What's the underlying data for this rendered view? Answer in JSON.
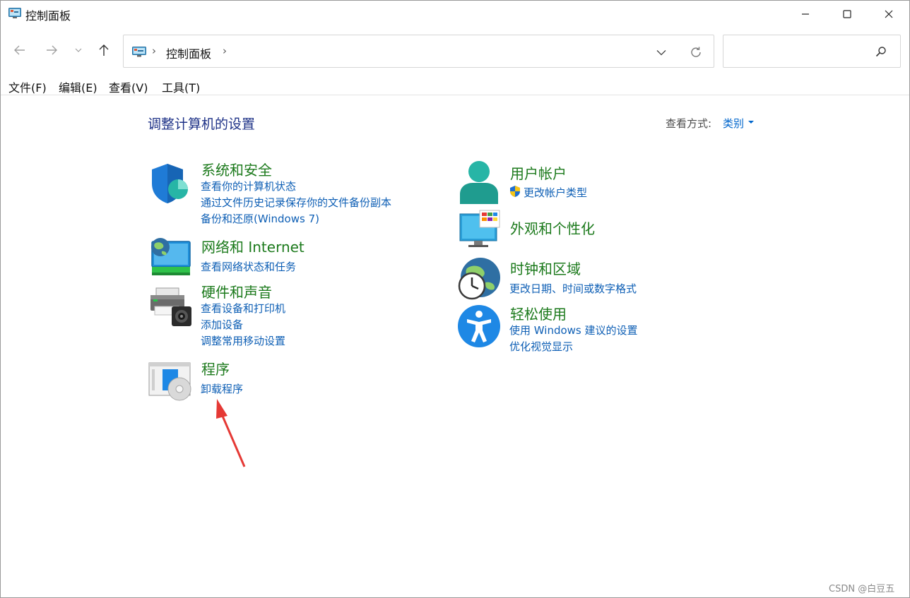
{
  "window": {
    "title": "控制面板",
    "controls": {
      "minimize": "minimize",
      "maximize": "maximize",
      "close": "close"
    }
  },
  "nav": {
    "address_path": "控制面板",
    "search_placeholder": ""
  },
  "menu": {
    "items": [
      {
        "label": "文件(F)"
      },
      {
        "label": "编辑(E)"
      },
      {
        "label": "查看(V)"
      },
      {
        "label": "工具(T)"
      }
    ]
  },
  "main": {
    "heading": "调整计算机的设置",
    "view_by_label": "查看方式:",
    "view_by_value": "类别",
    "categories": [
      {
        "title": "系统和安全",
        "icon": "shield-icon",
        "links": [
          "查看你的计算机状态",
          "通过文件历史记录保存你的文件备份副本",
          "备份和还原(Windows 7)"
        ]
      },
      {
        "title": "网络和 Internet",
        "icon": "network-globe-icon",
        "links": [
          "查看网络状态和任务"
        ]
      },
      {
        "title": "硬件和声音",
        "icon": "printer-icon",
        "links": [
          "查看设备和打印机",
          "添加设备",
          "调整常用移动设置"
        ]
      },
      {
        "title": "程序",
        "icon": "programs-disc-icon",
        "links": [
          "卸载程序"
        ]
      },
      {
        "title": "用户帐户",
        "icon": "user-account-icon",
        "links": [
          "更改帐户类型"
        ]
      },
      {
        "title": "外观和个性化",
        "icon": "monitor-personalize-icon",
        "links": []
      },
      {
        "title": "时钟和区域",
        "icon": "clock-globe-icon",
        "links": [
          "更改日期、时间或数字格式"
        ]
      },
      {
        "title": "轻松使用",
        "icon": "accessibility-icon",
        "links": [
          "使用 Windows 建议的设置",
          "优化视觉显示"
        ]
      }
    ]
  },
  "watermark": "CSDN @白豆五",
  "colors": {
    "title_green": "#1c7a1c",
    "link_blue": "#0e5fb5",
    "heading_blue": "#1e3287",
    "annotation_red": "#e53935"
  }
}
